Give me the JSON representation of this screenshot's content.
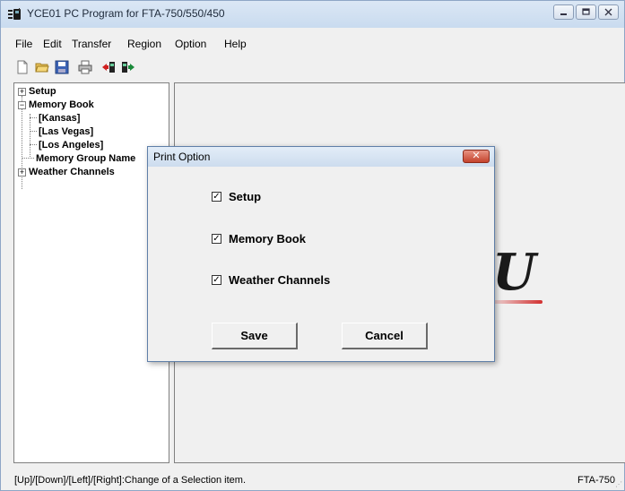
{
  "window": {
    "title": "YCE01 PC Program for FTA-750/550/450",
    "controls": [
      "minimize-icon",
      "maximize-icon",
      "close-icon"
    ]
  },
  "menu": {
    "items": [
      "File",
      "Edit",
      "Transfer",
      "Region",
      "Option",
      "Help"
    ]
  },
  "toolbar": {
    "buttons": [
      "new-file-icon",
      "open-folder-icon",
      "save-icon",
      "print-icon",
      "read-from-radio-icon",
      "write-to-radio-icon"
    ]
  },
  "tree": {
    "setup": "Setup",
    "memory_book": "Memory Book",
    "kansas": "[Kansas]",
    "las_vegas": "[Las Vegas]",
    "los_angeles": "[Los Angeles]",
    "memory_group_name": "Memory Group Name",
    "weather_channels": "Weather Channels",
    "expand_symbol": "+",
    "collapse_symbol": "−"
  },
  "dialog": {
    "title": "Print Option",
    "close_symbol": "✕",
    "options": [
      {
        "label": "Setup",
        "checked": true
      },
      {
        "label": "Memory Book",
        "checked": true
      },
      {
        "label": "Weather Channels",
        "checked": true
      }
    ],
    "check_mark": "✓",
    "save_label": "Save",
    "cancel_label": "Cancel"
  },
  "logo": {
    "partial_text": "U",
    "accent_color": "#d23030"
  },
  "status": {
    "left": "[Up]/[Down]/[Left]/[Right]:Change of a Selection item.",
    "right": "FTA-750"
  }
}
